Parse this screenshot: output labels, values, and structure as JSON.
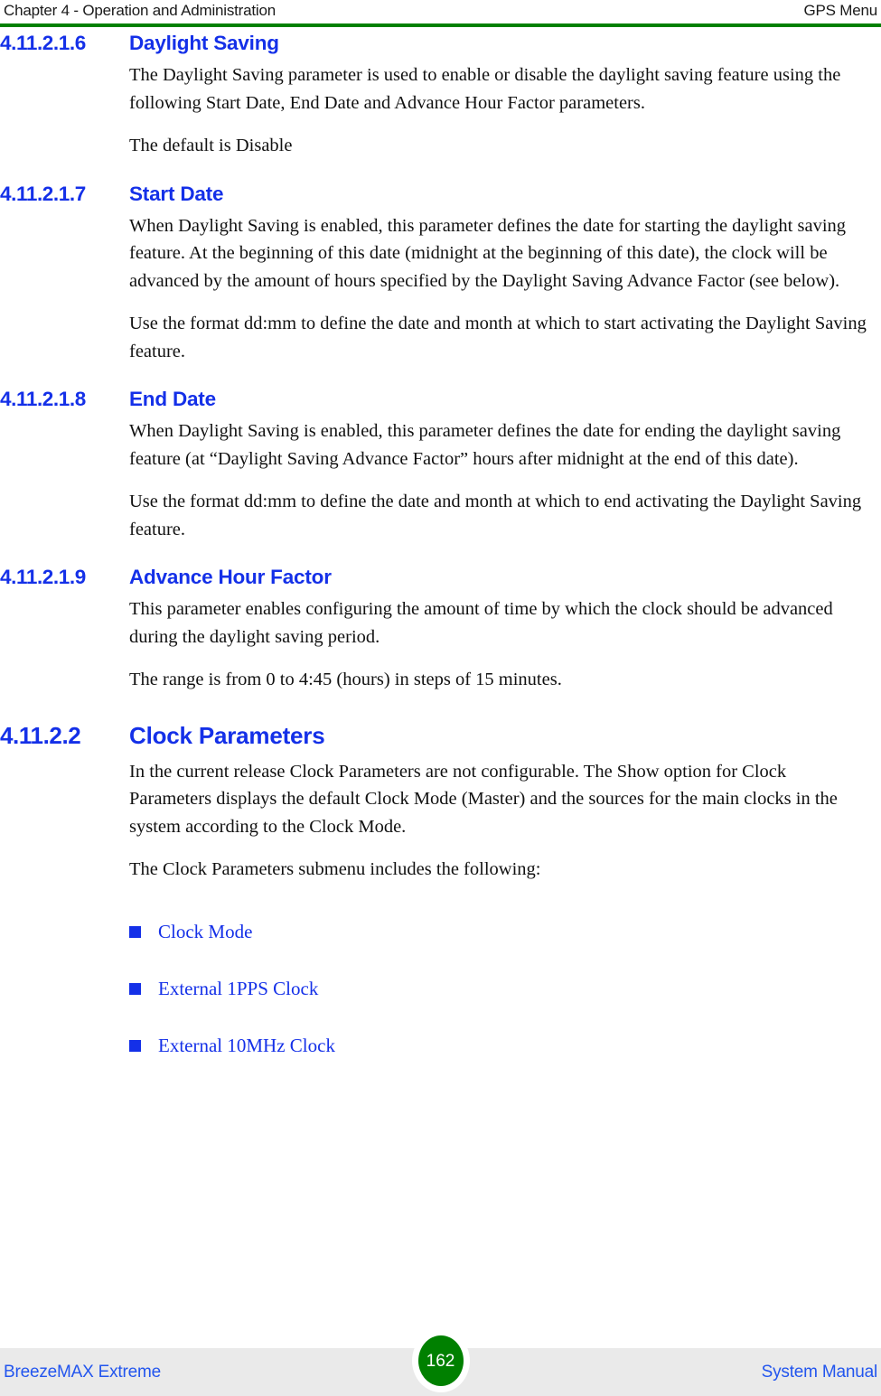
{
  "header": {
    "left": "Chapter 4 - Operation and Administration",
    "right": "GPS Menu",
    "rule_color": "#008000"
  },
  "colors": {
    "heading_blue": "#1430e8",
    "link_blue": "#1430e8",
    "footer_link_blue": "#2255ee",
    "rule_green": "#008000",
    "footer_band": "#eaeaea",
    "badge_green": "#008000",
    "body_text": "#111111"
  },
  "sections": [
    {
      "number": "4.11.2.1.6",
      "title": "Daylight Saving",
      "level": "h4",
      "paragraphs": [
        "The Daylight Saving parameter is used to enable or disable the daylight saving feature using the following Start Date, End Date and Advance Hour Factor parameters.",
        "The default is Disable"
      ]
    },
    {
      "number": "4.11.2.1.7",
      "title": "Start Date",
      "level": "h4",
      "paragraphs": [
        "When Daylight Saving is enabled, this parameter defines the date for starting the daylight saving feature. At the beginning of this date (midnight at the beginning of this date), the clock will be advanced by the amount of hours specified by the Daylight Saving Advance Factor (see below).",
        "Use the format dd:mm to define the date and month at which to start activating the Daylight Saving feature."
      ]
    },
    {
      "number": "4.11.2.1.8",
      "title": "End Date",
      "level": "h4",
      "paragraphs": [
        "When Daylight Saving is enabled, this parameter defines the date for ending the daylight saving feature (at “Daylight Saving Advance Factor” hours after midnight at the end of this date).",
        "Use the format dd:mm to define the date and month at which to end activating the Daylight Saving feature."
      ]
    },
    {
      "number": "4.11.2.1.9",
      "title": "Advance Hour Factor",
      "level": "h4",
      "paragraphs": [
        "This parameter enables configuring the amount of time by which the clock should be advanced during the daylight saving period.",
        "The range is from 0 to 4:45 (hours) in steps of 15 minutes."
      ]
    },
    {
      "number": "4.11.2.2",
      "title": "Clock Parameters",
      "level": "h3",
      "paragraphs": [
        "In the current release Clock Parameters are not configurable. The Show option for Clock Parameters displays the default Clock Mode (Master) and the sources for the main clocks in the system according to the Clock Mode.",
        "The Clock Parameters submenu includes the following:"
      ]
    }
  ],
  "bullet_list": {
    "bullet_icon": "square-bullet-icon",
    "items": [
      {
        "label": "Clock Mode"
      },
      {
        "label": "External 1PPS Clock"
      },
      {
        "label": "External 10MHz Clock"
      }
    ]
  },
  "footer": {
    "left": "BreezeMAX Extreme",
    "page_number": "162",
    "right": "System Manual"
  }
}
